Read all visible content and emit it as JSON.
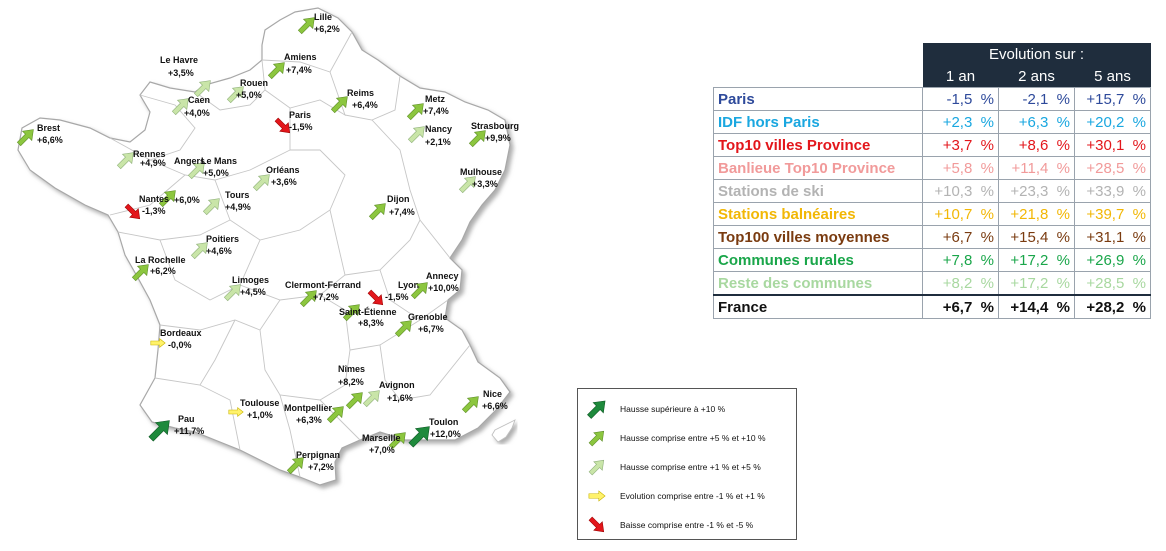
{
  "map": {
    "cities": [
      {
        "name": "Lille",
        "value": "+6,2%",
        "trend": "medium"
      },
      {
        "name": "Le Havre",
        "value": "+3,5%",
        "trend": "light"
      },
      {
        "name": "Amiens",
        "value": "+7,4%",
        "trend": "medium"
      },
      {
        "name": "Rouen",
        "value": "+5,0%",
        "trend": "light"
      },
      {
        "name": "Reims",
        "value": "+6,4%",
        "trend": "medium"
      },
      {
        "name": "Metz",
        "value": "+7,4%",
        "trend": "medium"
      },
      {
        "name": "Caen",
        "value": "+4,0%",
        "trend": "light"
      },
      {
        "name": "Paris",
        "value": "-1,5%",
        "trend": "down"
      },
      {
        "name": "Nancy",
        "value": "+2,1%",
        "trend": "light"
      },
      {
        "name": "Brest",
        "value": "+6,6%",
        "trend": "medium"
      },
      {
        "name": "Strasbourg",
        "value": "+9,9%",
        "trend": "medium"
      },
      {
        "name": "Rennes",
        "value": "+4,9%",
        "trend": "light"
      },
      {
        "name": "Le Mans",
        "value": "+5,0%",
        "trend": "light"
      },
      {
        "name": "Orléans",
        "value": "+3,6%",
        "trend": "light"
      },
      {
        "name": "Mulhouse",
        "value": "+3,3%",
        "trend": "light"
      },
      {
        "name": "Angers",
        "value": "+6,0%",
        "trend": "medium"
      },
      {
        "name": "Nantes",
        "value": "-1,3%",
        "trend": "down"
      },
      {
        "name": "Tours",
        "value": "+4,9%",
        "trend": "light"
      },
      {
        "name": "Dijon",
        "value": "+7,4%",
        "trend": "medium"
      },
      {
        "name": "Poitiers",
        "value": "+4,6%",
        "trend": "light"
      },
      {
        "name": "La Rochelle",
        "value": "+6,2%",
        "trend": "medium"
      },
      {
        "name": "Limoges",
        "value": "+4,5%",
        "trend": "light"
      },
      {
        "name": "Clermont-Ferrand",
        "value": "+7,2%",
        "trend": "medium"
      },
      {
        "name": "Lyon",
        "value": "-1,5%",
        "trend": "down"
      },
      {
        "name": "Annecy",
        "value": "+10,0%",
        "trend": "medium"
      },
      {
        "name": "Saint-Étienne",
        "value": "+8,3%",
        "trend": "medium"
      },
      {
        "name": "Grenoble",
        "value": "+6,7%",
        "trend": "medium"
      },
      {
        "name": "Bordeaux",
        "value": "-0,0%",
        "trend": "flat"
      },
      {
        "name": "Nîmes",
        "value": "+8,2%",
        "trend": "medium"
      },
      {
        "name": "Avignon",
        "value": "+1,6%",
        "trend": "light"
      },
      {
        "name": "Nice",
        "value": "+6,6%",
        "trend": "medium"
      },
      {
        "name": "Toulouse",
        "value": "+1,0%",
        "trend": "flat"
      },
      {
        "name": "Montpellier",
        "value": "+6,3%",
        "trend": "medium"
      },
      {
        "name": "Pau",
        "value": "+11,7%",
        "trend": "strong"
      },
      {
        "name": "Toulon",
        "value": "+12,0%",
        "trend": "strong"
      },
      {
        "name": "Marseille",
        "value": "+7,0%",
        "trend": "medium"
      },
      {
        "name": "Perpignan",
        "value": "+7,2%",
        "trend": "medium"
      }
    ]
  },
  "trend_colors": {
    "strong": "#1e8a3c",
    "medium": "#8cc63f",
    "light": "#c9e5a8",
    "flat": "#fff26b",
    "down": "#e3161b"
  },
  "table": {
    "header_title": "Evolution sur :",
    "col_headers": [
      "1 an",
      "2 ans",
      "5 ans"
    ],
    "rows": [
      {
        "label": "Paris",
        "color": "#2e4a9b",
        "values": [
          "-1,5  %",
          "-2,1  %",
          "+15,7  %"
        ]
      },
      {
        "label": "IDF hors Paris",
        "color": "#1aa7e0",
        "values": [
          "+2,3  %",
          "+6,3  %",
          "+20,2  %"
        ]
      },
      {
        "label": "Top10 villes Province",
        "color": "#e3161b",
        "values": [
          "+3,7  %",
          "+8,6  %",
          "+30,1  %"
        ]
      },
      {
        "label": "Banlieue Top10 Province",
        "color": "#f19a9a",
        "values": [
          "+5,8  %",
          "+11,4  %",
          "+28,5  %"
        ]
      },
      {
        "label": "Stations de ski",
        "color": "#b3b3b3",
        "values": [
          "+10,3  %",
          "+23,3  %",
          "+33,9  %"
        ]
      },
      {
        "label": "Stations balnéaires",
        "color": "#f2b705",
        "values": [
          "+10,7  %",
          "+21,8  %",
          "+39,7  %"
        ]
      },
      {
        "label": "Top100 villes moyennes",
        "color": "#7a3b10",
        "values": [
          "+6,7  %",
          "+15,4  %",
          "+31,1  %"
        ]
      },
      {
        "label": "Communes rurales",
        "color": "#1aa64a",
        "values": [
          "+7,8  %",
          "+17,2  %",
          "+26,9  %"
        ]
      },
      {
        "label": "Reste des communes",
        "color": "#a8d8a0",
        "values": [
          "+8,2  %",
          "+17,2  %",
          "+28,5  %"
        ]
      }
    ],
    "total": {
      "label": "France",
      "color": "#111111",
      "values": [
        "+6,7  %",
        "+14,4  %",
        "+28,2  %"
      ]
    }
  },
  "legend": {
    "items": [
      {
        "trend": "strong",
        "label": "Hausse supérieure à +10 %"
      },
      {
        "trend": "medium",
        "label": "Hausse comprise entre +5 % et +10 %"
      },
      {
        "trend": "light",
        "label": "Hausse comprise entre +1 % et +5 %"
      },
      {
        "trend": "flat",
        "label": "Evolution comprise entre -1 % et +1 %"
      },
      {
        "trend": "down",
        "label": "Baisse comprise entre -1 % et -5 %"
      }
    ]
  }
}
